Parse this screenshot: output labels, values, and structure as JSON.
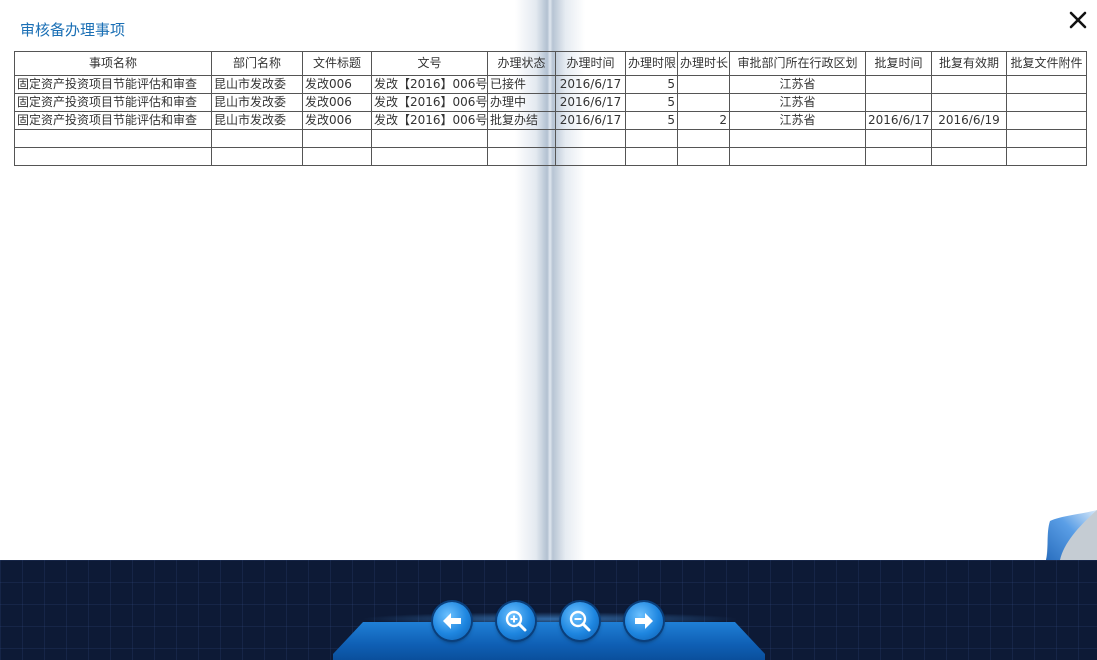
{
  "title": "审核备办理事项",
  "table": {
    "headers": [
      "事项名称",
      "部门名称",
      "文件标题",
      "文号",
      "办理状态",
      "办理时间",
      "办理时限",
      "办理时长",
      "审批部门所在行政区划",
      "批复时间",
      "批复有效期",
      "批复文件附件"
    ],
    "rows": [
      [
        "固定资产投资项目节能评估和审查",
        "昆山市发改委",
        "发改006",
        "发改【2016】006号",
        "已接件",
        "2016/6/17",
        "5",
        "",
        "江苏省",
        "",
        "",
        ""
      ],
      [
        "固定资产投资项目节能评估和审查",
        "昆山市发改委",
        "发改006",
        "发改【2016】006号",
        "办理中",
        "2016/6/17",
        "5",
        "",
        "江苏省",
        "",
        "",
        ""
      ],
      [
        "固定资产投资项目节能评估和审查",
        "昆山市发改委",
        "发改006",
        "发改【2016】006号",
        "批复办结",
        "2016/6/17",
        "5",
        "2",
        "江苏省",
        "2016/6/17",
        "2016/6/19",
        ""
      ],
      [
        "",
        "",
        "",
        "",
        "",
        "",
        "",
        "",
        "",
        "",
        "",
        ""
      ],
      [
        "",
        "",
        "",
        "",
        "",
        "",
        "",
        "",
        "",
        "",
        "",
        ""
      ]
    ]
  },
  "icons": {
    "close": "close-icon",
    "prev": "arrow-left-icon",
    "zoom_in": "zoom-in-icon",
    "zoom_out": "zoom-out-icon",
    "next": "arrow-right-icon"
  },
  "colors": {
    "title": "#1a6fb5",
    "toolbar_bg": "#0d1a36",
    "button": "#1e86e0"
  }
}
